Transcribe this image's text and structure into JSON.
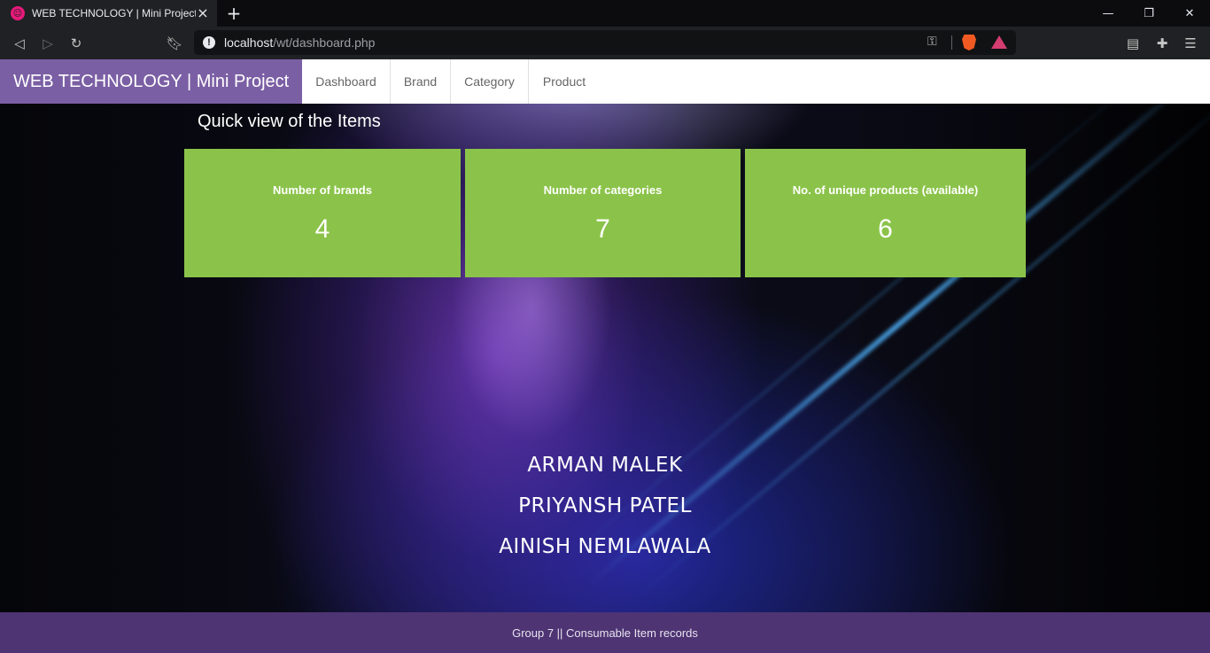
{
  "browser": {
    "tab_title": "WEB TECHNOLOGY | Mini Project",
    "url_host": "localhost",
    "url_path": "/wt/dashboard.php"
  },
  "navbar": {
    "brand": "WEB TECHNOLOGY | Mini Project",
    "items": [
      "Dashboard",
      "Brand",
      "Category",
      "Product"
    ]
  },
  "dashboard": {
    "heading": "Quick view of the Items",
    "cards": [
      {
        "label": "Number of brands",
        "value": "4"
      },
      {
        "label": "Number of categories",
        "value": "7"
      },
      {
        "label": "No. of unique products (available)",
        "value": "6"
      }
    ],
    "members": [
      "ARMAN MALEK",
      "PRIYANSH PATEL",
      "AINISH NEMLAWALA"
    ]
  },
  "footer": {
    "text": "Group 7 || Consumable Item records"
  },
  "colors": {
    "brand_bg": "#7b5fa4",
    "card_bg": "#8bc34a",
    "footer_bg": "#4e3473"
  }
}
